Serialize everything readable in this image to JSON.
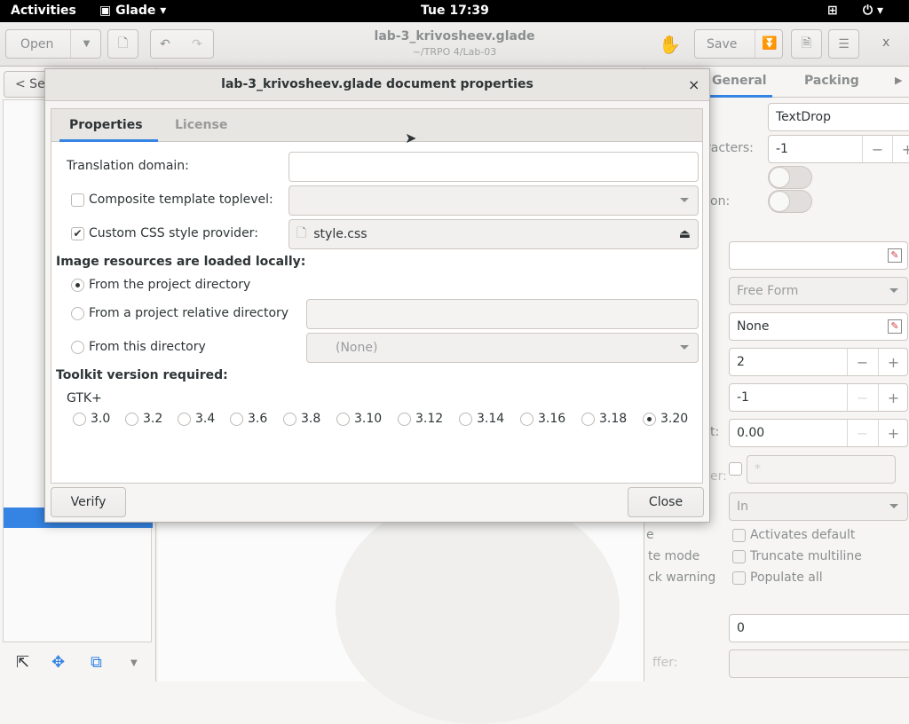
{
  "topbar": {
    "activities": "Activities",
    "app": "Glade",
    "clock": "Tue 17:39"
  },
  "header": {
    "open": "Open",
    "title": "lab-3_krivosheev.glade",
    "subtitle": "~/TRPO 4/Lab-03",
    "save": "Save",
    "close": "x"
  },
  "left": {
    "search": "< Se"
  },
  "right": {
    "tabs": [
      "General",
      "Packing"
    ],
    "labels": {
      "characters": "racters:",
      "on": "on:",
      "t": "t:",
      "er": "er:",
      "e": "e",
      "mode": "te mode",
      "warning": "ck warning",
      "buffer": "ffer:"
    },
    "name_value": "TextDrop",
    "max_chars": "-1",
    "free_form": "Free Form",
    "none": "None",
    "spin2": "2",
    "spin_neg1": "-1",
    "spin0": "0.00",
    "invisible_char": "*",
    "in": "In",
    "checks": [
      "Activates default",
      "Truncate multiline",
      "Populate all"
    ],
    "zero": "0"
  },
  "dialog": {
    "title": "lab-3_krivosheev.glade document properties",
    "close": "×",
    "tabs": [
      "Properties",
      "License"
    ],
    "translation_domain": "Translation domain:",
    "composite": "Composite template toplevel:",
    "custom_css": "Custom CSS style provider:",
    "css_file": "style.css",
    "image_heading": "Image resources are loaded locally:",
    "from_project": "From the project directory",
    "from_relative": "From a project relative directory",
    "from_this": "From this directory",
    "none_option": "(None)",
    "toolkit_heading": "Toolkit version required:",
    "gtk": "GTK+",
    "versions": [
      "3.0",
      "3.2",
      "3.4",
      "3.6",
      "3.8",
      "3.10",
      "3.12",
      "3.14",
      "3.16",
      "3.18",
      "3.20"
    ],
    "selected_version": "3.20",
    "verify": "Verify",
    "close_button": "Close"
  },
  "colors": {
    "accent": "#3584e4",
    "selection": "#3584e4"
  }
}
